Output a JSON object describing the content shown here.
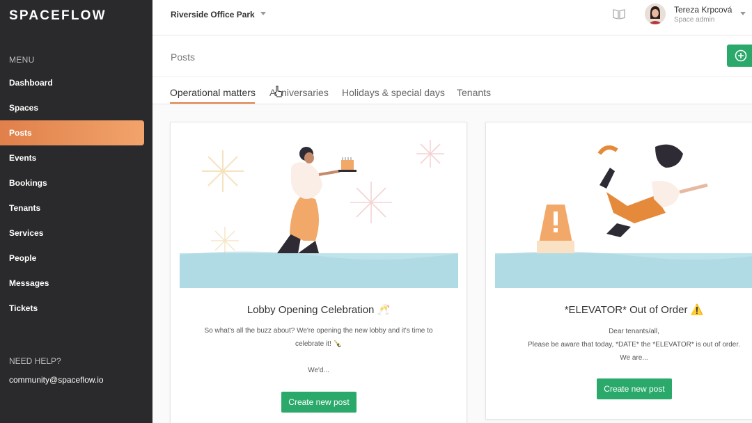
{
  "brand": "SPACEFLOW",
  "sidebar": {
    "menu_title": "MENU",
    "items": [
      {
        "label": "Dashboard"
      },
      {
        "label": "Spaces"
      },
      {
        "label": "Posts"
      },
      {
        "label": "Events"
      },
      {
        "label": "Bookings"
      },
      {
        "label": "Tenants"
      },
      {
        "label": "Services"
      },
      {
        "label": "People"
      },
      {
        "label": "Messages"
      },
      {
        "label": "Tickets"
      }
    ],
    "active_item": "Posts",
    "help_title": "NEED HELP?",
    "help_email": "community@spaceflow.io"
  },
  "topbar": {
    "location": "Riverside Office Park",
    "user_name": "Tereza Krpcová",
    "user_role": "Space admin"
  },
  "page": {
    "title": "Posts"
  },
  "tabs": [
    {
      "label": "Operational matters",
      "active": true
    },
    {
      "label": "Anniversaries",
      "active": false
    },
    {
      "label": "Holidays & special days",
      "active": false
    },
    {
      "label": "Tenants",
      "active": false
    }
  ],
  "cards": [
    {
      "title": "Lobby Opening Celebration 🥂",
      "body_line1": "So what's all the buzz about? We're opening the new lobby and it's time to",
      "body_line2": "celebrate it! 🍾",
      "body_line3": "We'd...",
      "button": "Create new post"
    },
    {
      "title": "*ELEVATOR* Out of Order ⚠️",
      "body_line1": "Dear tenants/all,",
      "body_line2": "Please be aware that today, *DATE* the *ELEVATOR* is out of order.",
      "body_line3": "We are...",
      "button": "Create new post"
    }
  ],
  "colors": {
    "accent": "#e0804a",
    "primary_button": "#2aa96b",
    "sidebar_bg": "#2a2a2c"
  }
}
